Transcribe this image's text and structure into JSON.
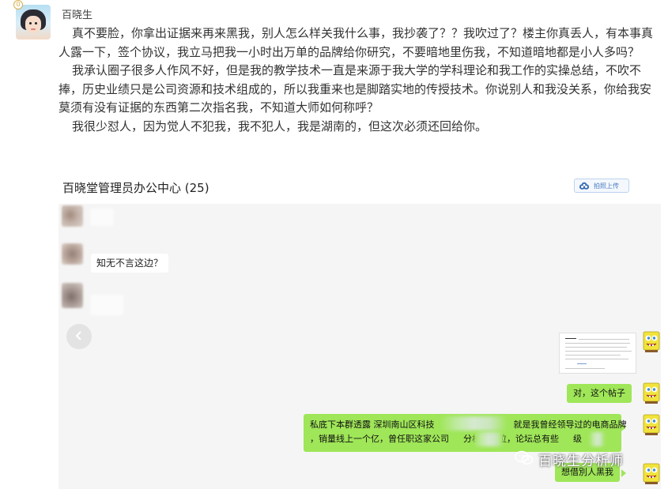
{
  "post": {
    "username": "百晓生",
    "badge": "0",
    "paragraphs": [
      "真不要脸，你拿出证据来再来黑我，别人怎么样关我什么事，我抄袭了？？我吹过了？楼主你真丢人，有本事真人露一下，签个协议，我立马把我一小时出万单的品牌给你研究，不要暗地里伤我，不知道暗地都是小人多吗？",
      "我承认圈子很多人作风不好，但是我的教学技术一直是来源于我大学的学科理论和我工作的实操总结，不吹不捧，历史业绩只是公司资源和技术组成的，所以我重来也是脚踏实地的传授技术。你说别人和我没关系，你给我安莫须有没有证据的东西第二次指名我，不知道大师如何称呼？",
      "我很少怼人，因为觉人不犯我，我不犯人，我是湖南的，但这次必须还回给你。"
    ]
  },
  "chat": {
    "title": "百晓堂管理员办公中心 (25)",
    "upload_label": "拍照上传",
    "upload_icon": "cloud-upload-icon",
    "left_messages": [
      {
        "text": ""
      },
      {
        "text": "知无不言这边？"
      },
      {
        "text": ""
      }
    ],
    "prev_icon": "chevron-left-icon",
    "right_messages": [
      {
        "text": "对，这个帖子"
      },
      {
        "line1_a": "私底下本群透露 深圳南山区科技",
        "line1_b": "就是我曾经领导过的电商品牌",
        "line2_a": "，销量线上一个亿，曾任职这家公司",
        "line2_b": "分析师职位，论坛总有些",
        "line2_c": "级"
      },
      {
        "text": "想借別人黑我"
      }
    ],
    "watermark": "百晓生分析师",
    "watermark_icon": "wechat-icon"
  }
}
